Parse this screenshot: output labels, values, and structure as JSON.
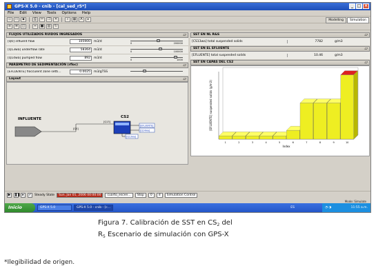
{
  "window": {
    "title": "GPS-X 5.0 - cnib - [cal_sed_r5*]",
    "minimize": "_",
    "maximize": "□",
    "close": "×"
  },
  "menu": [
    "File",
    "Edit",
    "View",
    "Tools",
    "Options",
    "Help"
  ],
  "modes": {
    "modelling": "Modelling",
    "simulation": "Simulation"
  },
  "flows_panel": {
    "title": "FLUJOS UTILIZADOS RUIDOS INGRESADOS",
    "rows": [
      {
        "label": "[Q0] influent flow",
        "value": "105900",
        "unit": "m3/d",
        "min": "0",
        "max": "200000",
        "level_fraction": 0.53
      },
      {
        "label": "[Q13wa] underflow rate",
        "value": "58364",
        "unit": "m3/d",
        "min": "0",
        "max": "100000",
        "level_fraction": 0.58
      },
      {
        "label": "[Q14wa] pumped flow",
        "value": "892",
        "unit": "m3/d",
        "min": "0",
        "max": "1000",
        "level_fraction": 0.89
      }
    ]
  },
  "sed_panel": {
    "title": "PARÁMETRO DE SEDIMENTACIÓN (rfloc)",
    "rows": [
      {
        "label": "[EFLUENTE] flocculent zone setti...",
        "value": "0.0025",
        "unit": "m3/gTSS",
        "level_fraction": 0.25
      }
    ]
  },
  "layout_panel": {
    "title": "Layout",
    "influent_label": "INFLUENTE",
    "unit_label": "CS2",
    "conn_labels": [
      "[Q0]",
      "[Q13]"
    ],
    "out_labels": [
      "[EFLUENTE]",
      "[Q14wa]",
      "[Q13wa]"
    ]
  },
  "sst_nl_panel": {
    "title": "SST EN NL R&S",
    "rows": [
      {
        "label": "[CS13wa] total suspended solids",
        "value": "7782",
        "unit": "g/m3"
      }
    ]
  },
  "sst_eff_panel": {
    "title": "SST EN EL EFLUENTE",
    "rows": [
      {
        "label": "[EFLUENTE] total suspended solids",
        "value": "10.46",
        "unit": "g/m3"
      }
    ]
  },
  "chart_panel": {
    "title": "SST EN CAPAS DEL CS2"
  },
  "chart_data": {
    "type": "bar",
    "ylabel": "[EFLUENTE] suspended solids (g/m3)",
    "xlabel": "Index",
    "categories": [
      "1",
      "2",
      "3",
      "4",
      "5",
      "6",
      "7",
      "8",
      "9",
      "10"
    ],
    "values": [
      0.4,
      0.4,
      0.4,
      0.4,
      0.4,
      1.1,
      4.5,
      4.5,
      4.5,
      8.0
    ],
    "ylim": [
      0,
      8.4
    ],
    "colors": {
      "bar": "#eeee22",
      "top": "#dd2222"
    }
  },
  "bottom": {
    "steady_state": "Steady State",
    "datetime": "Sun, Jan 01, 2006 00:00:00",
    "profile": "cuarto_escen...",
    "stop": "Stop",
    "time_value": "0",
    "time_unit": "d",
    "sim_control": "Simulation Control"
  },
  "status": "Mode: Simulate",
  "taskbar": {
    "start": "Inicio",
    "items": [
      "GPS-X 5.0",
      "GPS-X 5.0 - cnib - [c..."
    ],
    "lang": "ES",
    "time": "11:55 a.m."
  },
  "caption": {
    "line1_a": "Figura 7. Calibración de SST en CS",
    "line1_sub": "2",
    "line1_b": " del",
    "line2_a": "R",
    "line2_sub": "5",
    "line2_b": " Escenario de simulación con GPS-X"
  },
  "footnote": "*Ilegibilidad de origen."
}
